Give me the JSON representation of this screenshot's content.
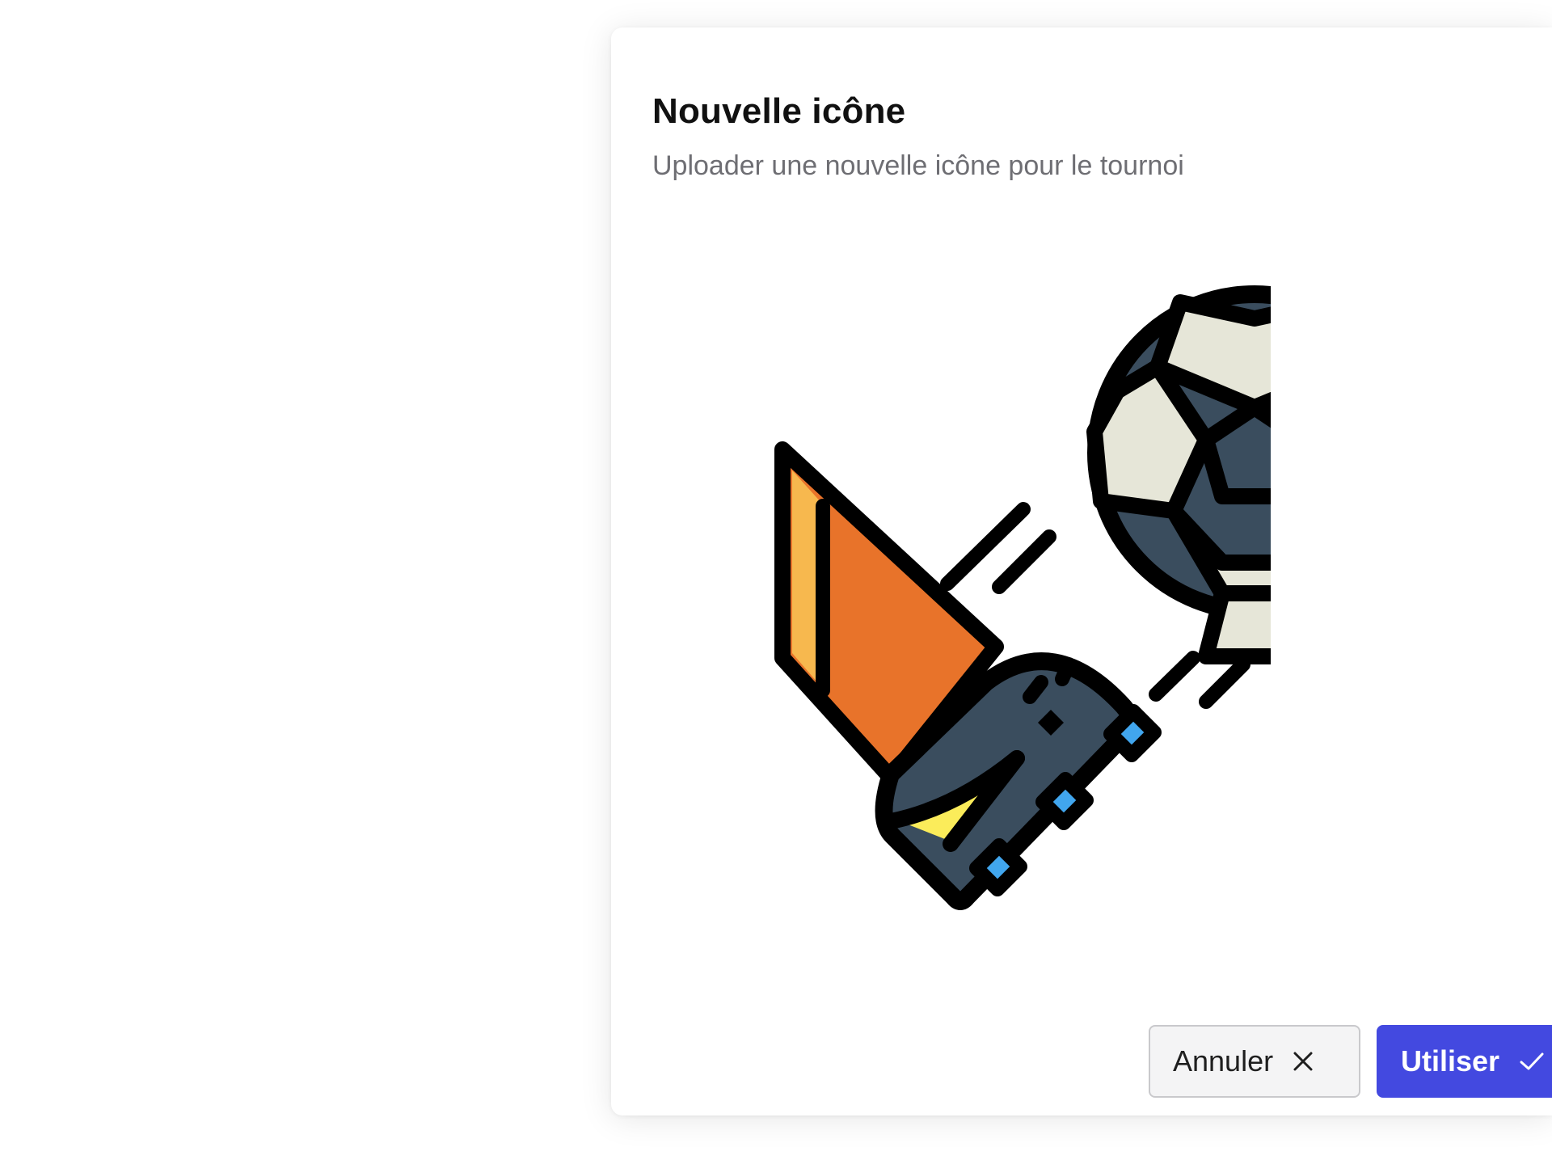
{
  "modal": {
    "title": "Nouvelle icône",
    "subtitle": "Uploader une nouvelle icône pour le tournoi",
    "preview_icon": "soccer-kick-icon"
  },
  "actions": {
    "cancel_label": "Annuler",
    "cancel_icon": "close-icon",
    "use_label": "Utiliser",
    "use_icon": "check-icon"
  },
  "colors": {
    "primary": "#4349e0",
    "boot": "#3a4d5e",
    "sock_orange": "#e8732a",
    "sock_light": "#f7b84e",
    "stripe_yellow": "#fbec5a",
    "studs": "#41a6ee",
    "ball_light": "#e6e6d8",
    "ball_dark": "#3a4d5e",
    "outline": "#000000"
  }
}
